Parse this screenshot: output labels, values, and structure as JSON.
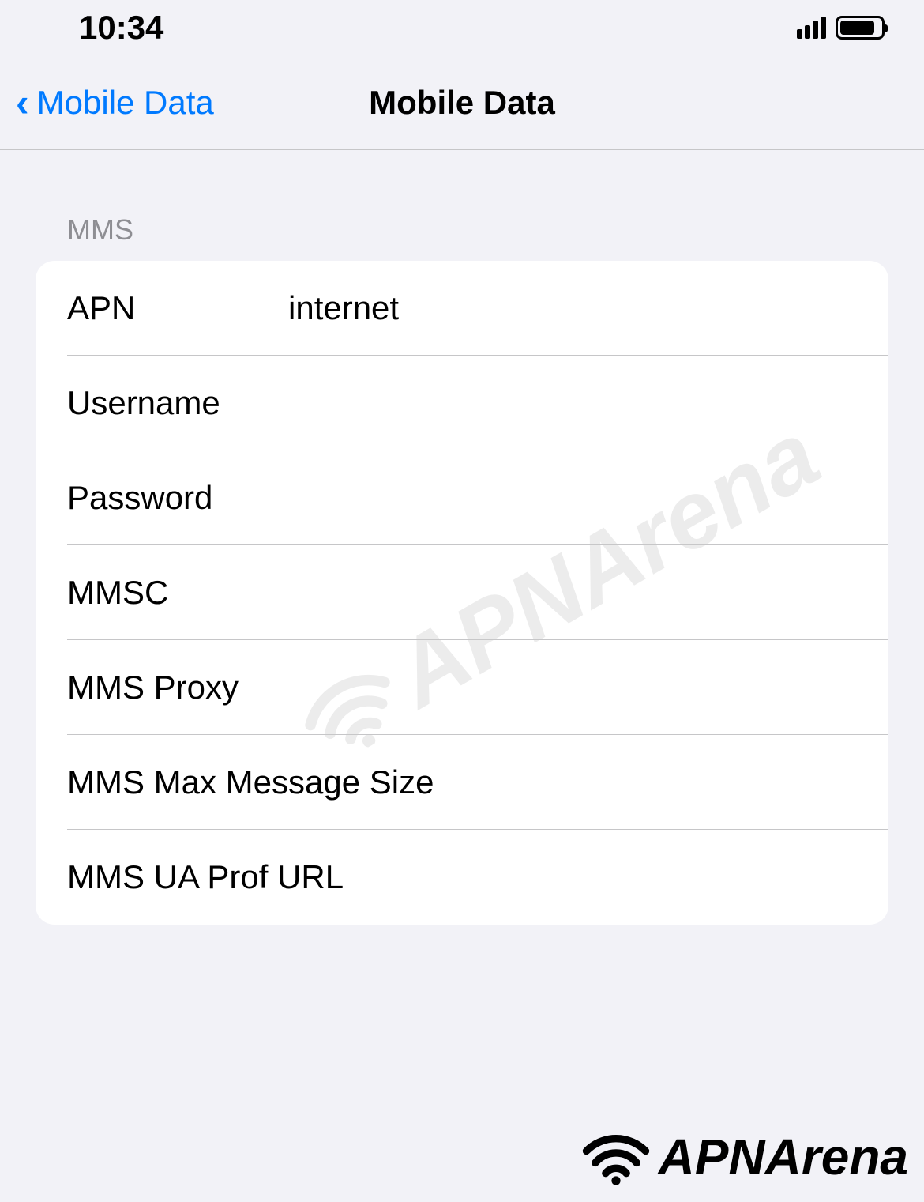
{
  "status": {
    "time": "10:34"
  },
  "nav": {
    "back_label": "Mobile Data",
    "title": "Mobile Data"
  },
  "section": {
    "header": "MMS"
  },
  "fields": {
    "apn": {
      "label": "APN",
      "value": "internet"
    },
    "username": {
      "label": "Username",
      "value": ""
    },
    "password": {
      "label": "Password",
      "value": ""
    },
    "mmsc": {
      "label": "MMSC",
      "value": ""
    },
    "mms_proxy": {
      "label": "MMS Proxy",
      "value": ""
    },
    "mms_max": {
      "label": "MMS Max Message Size",
      "value": ""
    },
    "mms_ua": {
      "label": "MMS UA Prof URL",
      "value": ""
    }
  },
  "branding": {
    "watermark": "APNArena",
    "footer": "APNArena"
  }
}
